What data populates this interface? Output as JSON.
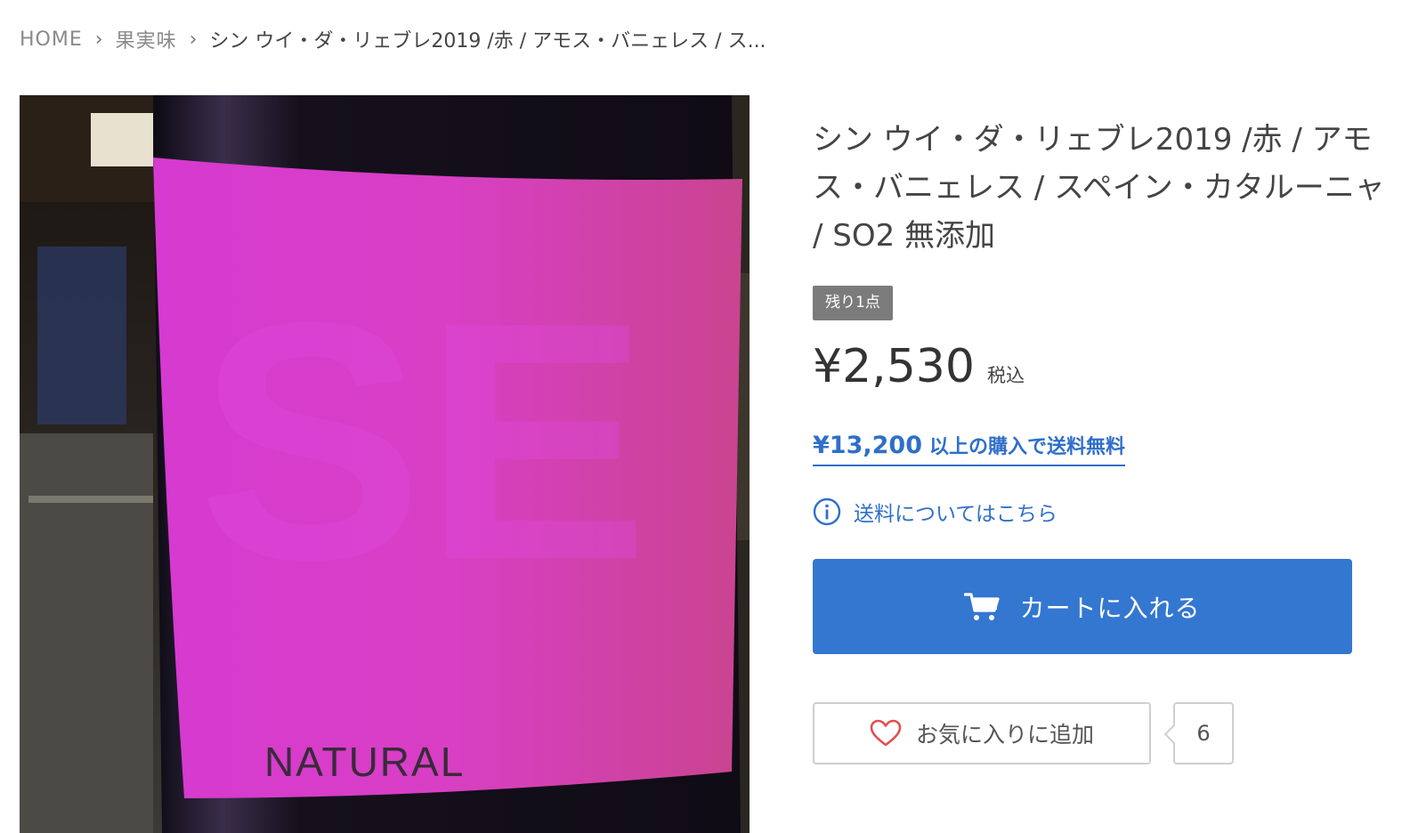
{
  "breadcrumb": {
    "home": "HOME",
    "category": "果実味",
    "current": "シン ウイ・ダ・リェブレ2019 /赤 / アモス・バニェレス / ス..."
  },
  "product": {
    "title": "シン ウイ・ダ・リェブレ2019 /赤 / アモス・バニェレス / スペイン・カタルーニャ / SO2 無添加",
    "image_label_text": "NATURAL",
    "stock_badge": "残り1点",
    "price": "¥2,530",
    "tax_label": "税込",
    "free_shipping_amount": "¥13,200",
    "free_shipping_text": "以上の購入で送料無料",
    "shipping_link": "送料についてはこちら",
    "cart_button": "カートに入れる",
    "favorite_button": "お気に入りに追加",
    "favorite_count": "6"
  },
  "colors": {
    "accent_blue": "#3477d1",
    "link_blue": "#2f6fc9",
    "badge_gray": "#7b7b7b",
    "heart_red": "#e05050",
    "label_magenta": "#d943c9"
  },
  "icons": {
    "breadcrumb_separator": "chevron-right-icon",
    "shipping_info": "info-circle-icon",
    "cart": "cart-icon",
    "favorite": "heart-outline-icon"
  }
}
